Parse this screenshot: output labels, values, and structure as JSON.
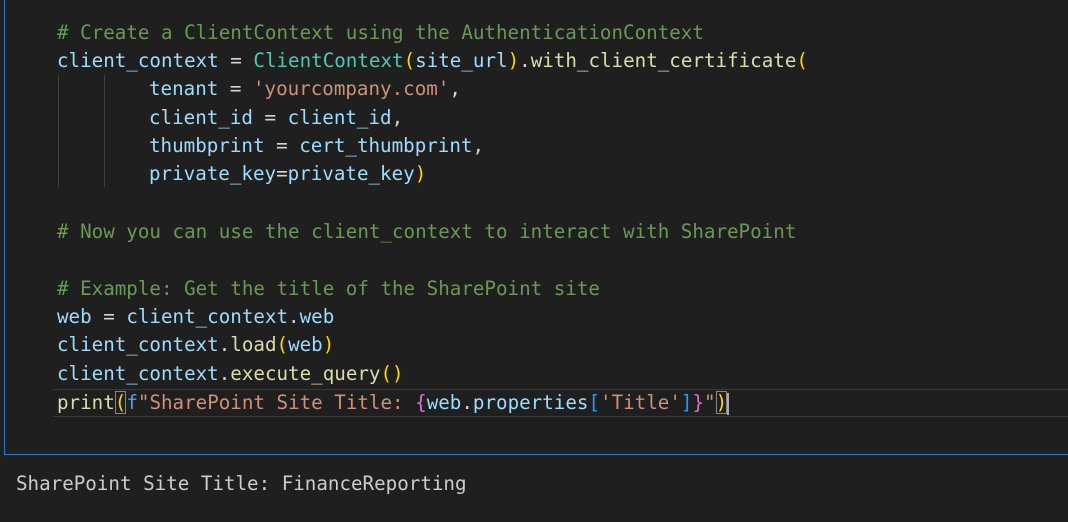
{
  "editor": {
    "lines": [
      [
        "# Create a ClientContext using the AuthenticationContext"
      ],
      [
        "client_context",
        " = ",
        "ClientContext",
        "(",
        "site_url",
        ")",
        ".",
        "with_client_certificate",
        "("
      ],
      [
        "tenant",
        " = ",
        "'yourcompany.com'",
        ","
      ],
      [
        "client_id",
        " = ",
        "client_id",
        ","
      ],
      [
        "thumbprint",
        " = ",
        "cert_thumbprint",
        ","
      ],
      [
        "private_key",
        "=",
        "private_key",
        ")"
      ],
      [
        "# Now you can use the client_context to interact with SharePoint"
      ],
      [
        "# Example: Get the title of the SharePoint site"
      ],
      [
        "web",
        " = ",
        "client_context",
        ".",
        "web"
      ],
      [
        "client_context",
        ".",
        "load",
        "(",
        "web",
        ")"
      ],
      [
        "client_context",
        ".",
        "execute_query",
        "()"
      ],
      [
        "print",
        "(",
        "f",
        "\"SharePoint Site Title: ",
        "{",
        "web",
        ".",
        "properties",
        "[",
        "'Title'",
        "]",
        "}",
        "\"",
        ")"
      ]
    ]
  },
  "output": {
    "text": "SharePoint Site Title: FinanceReporting"
  },
  "colors": {
    "background": "#1f1f1f",
    "comment": "#6a9955",
    "variable": "#9cdcfe",
    "class": "#4ec9b0",
    "function": "#dcdcaa",
    "string": "#ce9178",
    "bracket_level1": "#ffd700",
    "bracket_level2": "#da70d6",
    "bracket_level3": "#179fff",
    "focus_border": "#2b79c2"
  }
}
